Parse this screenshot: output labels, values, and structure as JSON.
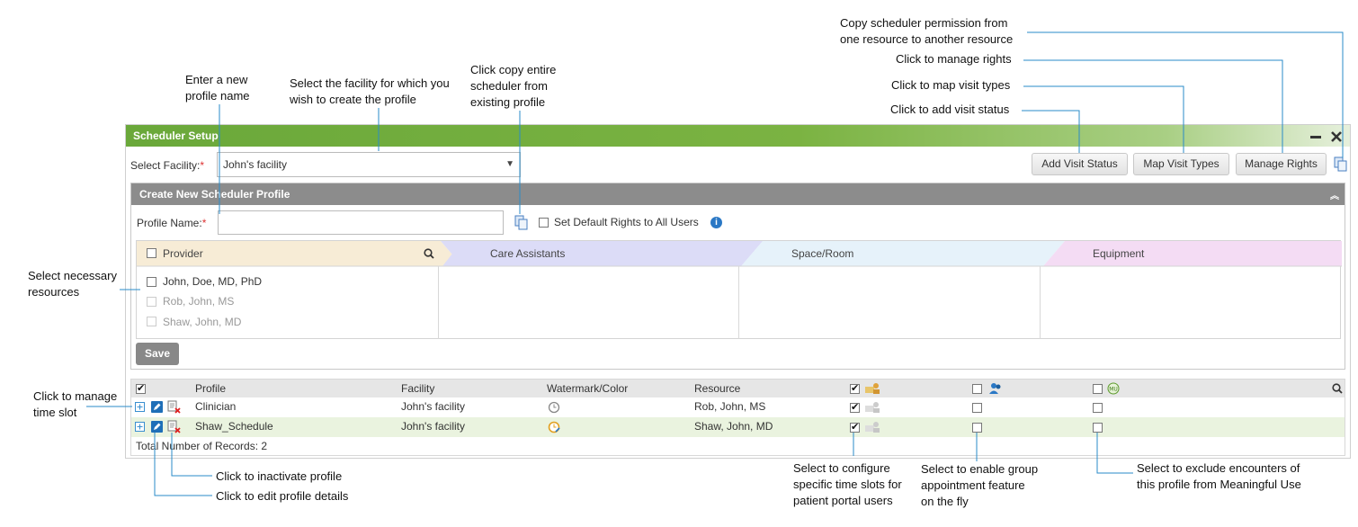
{
  "window": {
    "title": "Scheduler Setup"
  },
  "facility": {
    "label": "Select Facility:",
    "required_mark": "*",
    "selected": "John's facility"
  },
  "toolbar": {
    "add_visit_status": "Add Visit Status",
    "map_visit_types": "Map Visit Types",
    "manage_rights": "Manage Rights"
  },
  "panel": {
    "title": "Create New Scheduler Profile",
    "profile_name_label": "Profile Name:",
    "required_mark": "*",
    "default_rights_label": "Set Default Rights to All Users",
    "save_label": "Save"
  },
  "resources": {
    "tabs": [
      "Provider",
      "Care Assistants",
      "Space/Room",
      "Equipment"
    ],
    "providers": [
      "John, Doe, MD, PhD",
      "Rob, John, MS",
      "Shaw, John, MD"
    ]
  },
  "grid": {
    "headers": {
      "profile": "Profile",
      "facility": "Facility",
      "watermark": "Watermark/Color",
      "resource": "Resource"
    },
    "rows": [
      {
        "profile": "Clinician",
        "facility": "John's facility",
        "resource": "Rob, John, MS"
      },
      {
        "profile": "Shaw_Schedule",
        "facility": "John's facility",
        "resource": "Shaw, John, MD"
      }
    ],
    "total_label": "Total Number of Records: 2"
  },
  "annotations": {
    "copy_permission": [
      "Copy scheduler permission from",
      "one resource to another resource"
    ],
    "manage_rights": "Click to manage rights",
    "map_visit_types": "Click to map visit types",
    "add_visit_status": "Click to add visit status",
    "new_profile_name": [
      "Enter a new",
      "profile name"
    ],
    "select_facility": [
      "Select the facility for which you",
      "wish to create the profile"
    ],
    "copy_scheduler": [
      "Click copy entire",
      "scheduler from",
      "existing profile"
    ],
    "select_resources": [
      "Select necessary",
      "resources"
    ],
    "manage_time_slot": [
      "Click to manage",
      "time slot"
    ],
    "inactivate_profile": "Click to inactivate profile",
    "edit_profile": "Click to edit profile details",
    "patient_portal": [
      "Select to configure",
      "specific time slots for",
      "patient portal users"
    ],
    "group_appointment": [
      "Select to enable group",
      "appointment feature",
      "on the fly"
    ],
    "meaningful_use": [
      "Select to exclude encounters of",
      "this profile from Meaningful Use"
    ]
  },
  "colors": {
    "title_green": "#7bb342",
    "panel_gray": "#8c8c8c",
    "provider_tab": "#f7ecd6",
    "care_tab": "#dcdcf7",
    "space_tab": "#e6f2fa",
    "equipment_tab": "#f4dcf4",
    "selected_row": "#eaf3df",
    "line_blue": "#2a8bc9"
  },
  "icons": [
    "minimize-icon",
    "close-icon",
    "copy-icon",
    "info-icon",
    "search-icon",
    "expand-icon",
    "edit-icon",
    "inactivate-icon",
    "watermark-icon",
    "portal-users-icon",
    "group-icon",
    "mu-icon"
  ]
}
